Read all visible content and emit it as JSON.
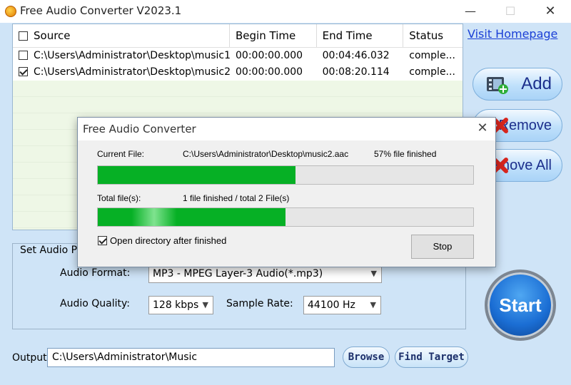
{
  "window": {
    "title": "Free Audio Converter V2023.1",
    "minimize": "—",
    "maximize": "☐",
    "close": "✕"
  },
  "table": {
    "columns": [
      "Source",
      "Begin Time",
      "End Time",
      "Status"
    ],
    "rows": [
      {
        "checked": false,
        "source": "C:\\Users\\Administrator\\Desktop\\music1...",
        "begin": "00:00:00.000",
        "end": "00:04:46.032",
        "status": "comple..."
      },
      {
        "checked": true,
        "source": "C:\\Users\\Administrator\\Desktop\\music2...",
        "begin": "00:00:00.000",
        "end": "00:08:20.114",
        "status": "comple..."
      }
    ]
  },
  "sidebar": {
    "visit_homepage": "Visit Homepage",
    "add": "Add",
    "remove": "Remove",
    "remove_all": "Remove All",
    "start": "Start"
  },
  "params": {
    "legend": "Set Audio Pa",
    "format_label": "Audio Format:",
    "format_value": "MP3 - MPEG Layer-3 Audio(*.mp3)",
    "quality_label": "Audio Quality:",
    "quality_value": "128 kbps",
    "rate_label": "Sample Rate:",
    "rate_value": "44100 Hz"
  },
  "output": {
    "label": "Output",
    "path": "C:\\Users\\Administrator\\Music",
    "browse": "Browse",
    "find_target": "Find Target"
  },
  "dialog": {
    "title": "Free Audio Converter",
    "close": "✕",
    "current_file_label": "Current File:",
    "current_file_value": "C:\\Users\\Administrator\\Desktop\\music2.aac",
    "current_file_percent_text": "57% file finished",
    "current_progress": 0.527,
    "total_files_label": "Total file(s):",
    "total_files_value": "1 file finished / total 2 File(s)",
    "total_progress": 0.5,
    "open_dir_checked": true,
    "open_dir_label": "Open directory after finished",
    "stop": "Stop"
  },
  "colors": {
    "background": "#cfe4f7",
    "progress_green": "#06b025",
    "link_blue": "#1a3fd6",
    "button_text": "#1c2f8c"
  },
  "icons": [
    "app-icon",
    "film-add-icon",
    "red-x-icon",
    "red-x-icon",
    "chevron-down-icon",
    "close-icon",
    "minimize-icon",
    "maximize-icon"
  ]
}
